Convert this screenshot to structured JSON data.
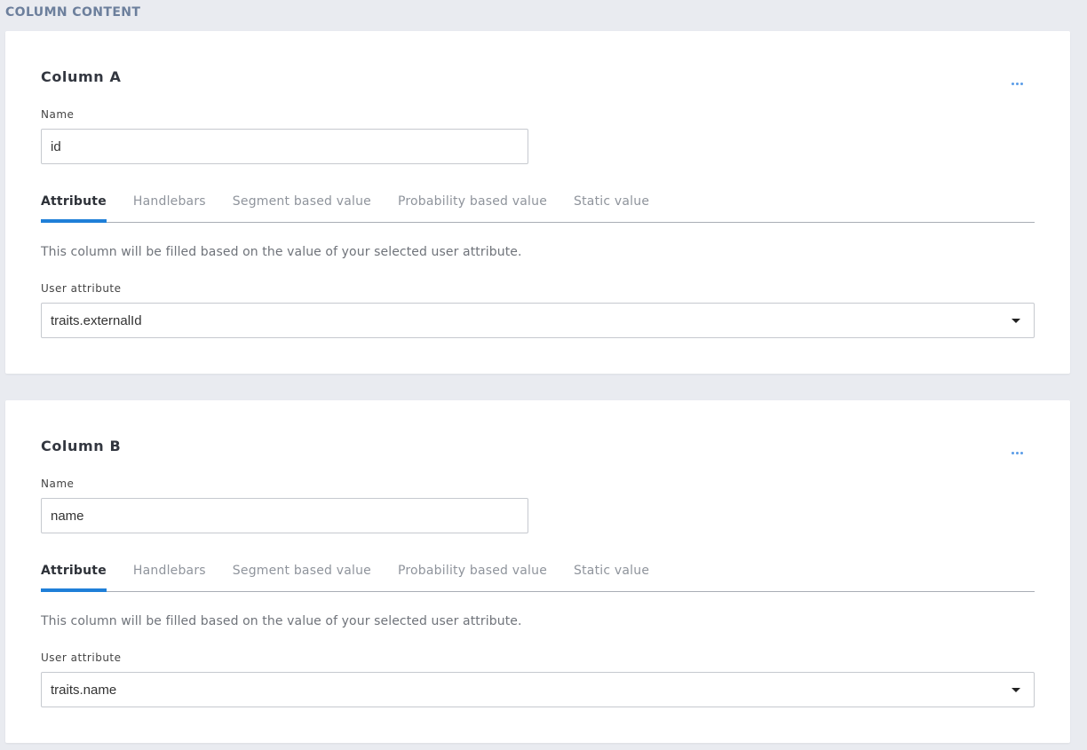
{
  "section_heading": "COLUMN CONTENT",
  "colors": {
    "accent": "#1f7fd8",
    "more_icon": "#5b9ee8",
    "heading": "#6c7f9c",
    "background": "#e9ebf0"
  },
  "icons": {
    "more": "more-horizontal-icon",
    "dropdown": "caret-down-icon"
  },
  "columns": [
    {
      "title": "Column A",
      "name_label": "Name",
      "name_value": "id",
      "tabs": [
        {
          "label": "Attribute",
          "active": true
        },
        {
          "label": "Handlebars",
          "active": false
        },
        {
          "label": "Segment based value",
          "active": false
        },
        {
          "label": "Probability based value",
          "active": false
        },
        {
          "label": "Static value",
          "active": false
        }
      ],
      "description": "This column will be filled based on the value of your selected user attribute.",
      "attribute_label": "User attribute",
      "attribute_value": "traits.externalId"
    },
    {
      "title": "Column B",
      "name_label": "Name",
      "name_value": "name",
      "tabs": [
        {
          "label": "Attribute",
          "active": true
        },
        {
          "label": "Handlebars",
          "active": false
        },
        {
          "label": "Segment based value",
          "active": false
        },
        {
          "label": "Probability based value",
          "active": false
        },
        {
          "label": "Static value",
          "active": false
        }
      ],
      "description": "This column will be filled based on the value of your selected user attribute.",
      "attribute_label": "User attribute",
      "attribute_value": "traits.name"
    }
  ]
}
